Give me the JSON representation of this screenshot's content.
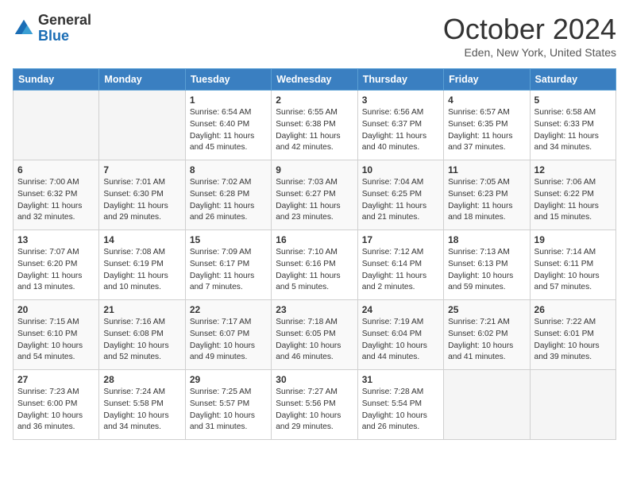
{
  "logo": {
    "line1": "General",
    "line2": "Blue"
  },
  "title": "October 2024",
  "subtitle": "Eden, New York, United States",
  "days_of_week": [
    "Sunday",
    "Monday",
    "Tuesday",
    "Wednesday",
    "Thursday",
    "Friday",
    "Saturday"
  ],
  "weeks": [
    [
      {
        "day": "",
        "info": ""
      },
      {
        "day": "",
        "info": ""
      },
      {
        "day": "1",
        "info": "Sunrise: 6:54 AM\nSunset: 6:40 PM\nDaylight: 11 hours and 45 minutes."
      },
      {
        "day": "2",
        "info": "Sunrise: 6:55 AM\nSunset: 6:38 PM\nDaylight: 11 hours and 42 minutes."
      },
      {
        "day": "3",
        "info": "Sunrise: 6:56 AM\nSunset: 6:37 PM\nDaylight: 11 hours and 40 minutes."
      },
      {
        "day": "4",
        "info": "Sunrise: 6:57 AM\nSunset: 6:35 PM\nDaylight: 11 hours and 37 minutes."
      },
      {
        "day": "5",
        "info": "Sunrise: 6:58 AM\nSunset: 6:33 PM\nDaylight: 11 hours and 34 minutes."
      }
    ],
    [
      {
        "day": "6",
        "info": "Sunrise: 7:00 AM\nSunset: 6:32 PM\nDaylight: 11 hours and 32 minutes."
      },
      {
        "day": "7",
        "info": "Sunrise: 7:01 AM\nSunset: 6:30 PM\nDaylight: 11 hours and 29 minutes."
      },
      {
        "day": "8",
        "info": "Sunrise: 7:02 AM\nSunset: 6:28 PM\nDaylight: 11 hours and 26 minutes."
      },
      {
        "day": "9",
        "info": "Sunrise: 7:03 AM\nSunset: 6:27 PM\nDaylight: 11 hours and 23 minutes."
      },
      {
        "day": "10",
        "info": "Sunrise: 7:04 AM\nSunset: 6:25 PM\nDaylight: 11 hours and 21 minutes."
      },
      {
        "day": "11",
        "info": "Sunrise: 7:05 AM\nSunset: 6:23 PM\nDaylight: 11 hours and 18 minutes."
      },
      {
        "day": "12",
        "info": "Sunrise: 7:06 AM\nSunset: 6:22 PM\nDaylight: 11 hours and 15 minutes."
      }
    ],
    [
      {
        "day": "13",
        "info": "Sunrise: 7:07 AM\nSunset: 6:20 PM\nDaylight: 11 hours and 13 minutes."
      },
      {
        "day": "14",
        "info": "Sunrise: 7:08 AM\nSunset: 6:19 PM\nDaylight: 11 hours and 10 minutes."
      },
      {
        "day": "15",
        "info": "Sunrise: 7:09 AM\nSunset: 6:17 PM\nDaylight: 11 hours and 7 minutes."
      },
      {
        "day": "16",
        "info": "Sunrise: 7:10 AM\nSunset: 6:16 PM\nDaylight: 11 hours and 5 minutes."
      },
      {
        "day": "17",
        "info": "Sunrise: 7:12 AM\nSunset: 6:14 PM\nDaylight: 11 hours and 2 minutes."
      },
      {
        "day": "18",
        "info": "Sunrise: 7:13 AM\nSunset: 6:13 PM\nDaylight: 10 hours and 59 minutes."
      },
      {
        "day": "19",
        "info": "Sunrise: 7:14 AM\nSunset: 6:11 PM\nDaylight: 10 hours and 57 minutes."
      }
    ],
    [
      {
        "day": "20",
        "info": "Sunrise: 7:15 AM\nSunset: 6:10 PM\nDaylight: 10 hours and 54 minutes."
      },
      {
        "day": "21",
        "info": "Sunrise: 7:16 AM\nSunset: 6:08 PM\nDaylight: 10 hours and 52 minutes."
      },
      {
        "day": "22",
        "info": "Sunrise: 7:17 AM\nSunset: 6:07 PM\nDaylight: 10 hours and 49 minutes."
      },
      {
        "day": "23",
        "info": "Sunrise: 7:18 AM\nSunset: 6:05 PM\nDaylight: 10 hours and 46 minutes."
      },
      {
        "day": "24",
        "info": "Sunrise: 7:19 AM\nSunset: 6:04 PM\nDaylight: 10 hours and 44 minutes."
      },
      {
        "day": "25",
        "info": "Sunrise: 7:21 AM\nSunset: 6:02 PM\nDaylight: 10 hours and 41 minutes."
      },
      {
        "day": "26",
        "info": "Sunrise: 7:22 AM\nSunset: 6:01 PM\nDaylight: 10 hours and 39 minutes."
      }
    ],
    [
      {
        "day": "27",
        "info": "Sunrise: 7:23 AM\nSunset: 6:00 PM\nDaylight: 10 hours and 36 minutes."
      },
      {
        "day": "28",
        "info": "Sunrise: 7:24 AM\nSunset: 5:58 PM\nDaylight: 10 hours and 34 minutes."
      },
      {
        "day": "29",
        "info": "Sunrise: 7:25 AM\nSunset: 5:57 PM\nDaylight: 10 hours and 31 minutes."
      },
      {
        "day": "30",
        "info": "Sunrise: 7:27 AM\nSunset: 5:56 PM\nDaylight: 10 hours and 29 minutes."
      },
      {
        "day": "31",
        "info": "Sunrise: 7:28 AM\nSunset: 5:54 PM\nDaylight: 10 hours and 26 minutes."
      },
      {
        "day": "",
        "info": ""
      },
      {
        "day": "",
        "info": ""
      }
    ]
  ]
}
